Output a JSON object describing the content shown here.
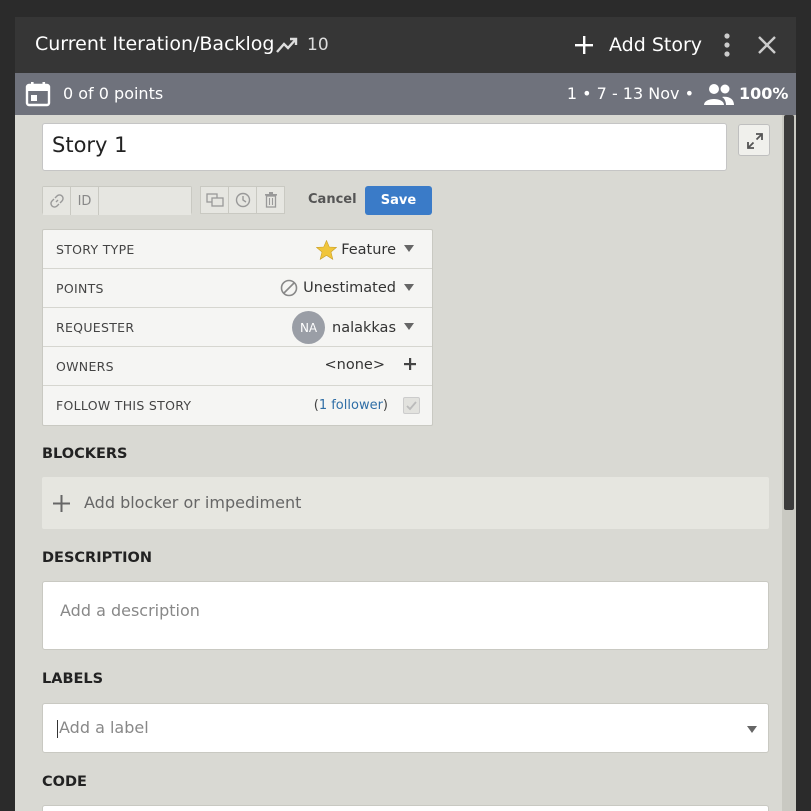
{
  "header": {
    "title": "Current Iteration/Backlog",
    "velocity": "10",
    "add_story_label": "Add Story"
  },
  "subheader": {
    "points": "0 of 0 points",
    "iteration": "1 • 7 - 13 Nov •",
    "team_strength": "100%"
  },
  "story": {
    "name": "Story 1",
    "id_label": "ID",
    "cancel_label": "Cancel",
    "save_label": "Save"
  },
  "fields": {
    "story_type": {
      "label": "STORY TYPE",
      "value": "Feature"
    },
    "points": {
      "label": "POINTS",
      "value": "Unestimated"
    },
    "requester": {
      "label": "REQUESTER",
      "initials": "NA",
      "value": "nalakkas"
    },
    "owners": {
      "label": "OWNERS",
      "value": "<none>"
    },
    "follow": {
      "label": "FOLLOW THIS STORY",
      "open": "(",
      "link": "1 follower",
      "close": ")"
    }
  },
  "blockers": {
    "heading": "BLOCKERS",
    "add_label": "Add blocker or impediment"
  },
  "description": {
    "heading": "DESCRIPTION",
    "placeholder": "Add a description"
  },
  "labels": {
    "heading": "LABELS",
    "placeholder": "Add a label"
  },
  "code": {
    "heading": "CODE"
  },
  "colors": {
    "save_button": "#3a7bc8",
    "titlebar": "#363636",
    "subbar": "#6f727c",
    "feature_star": "#f0c53a"
  }
}
